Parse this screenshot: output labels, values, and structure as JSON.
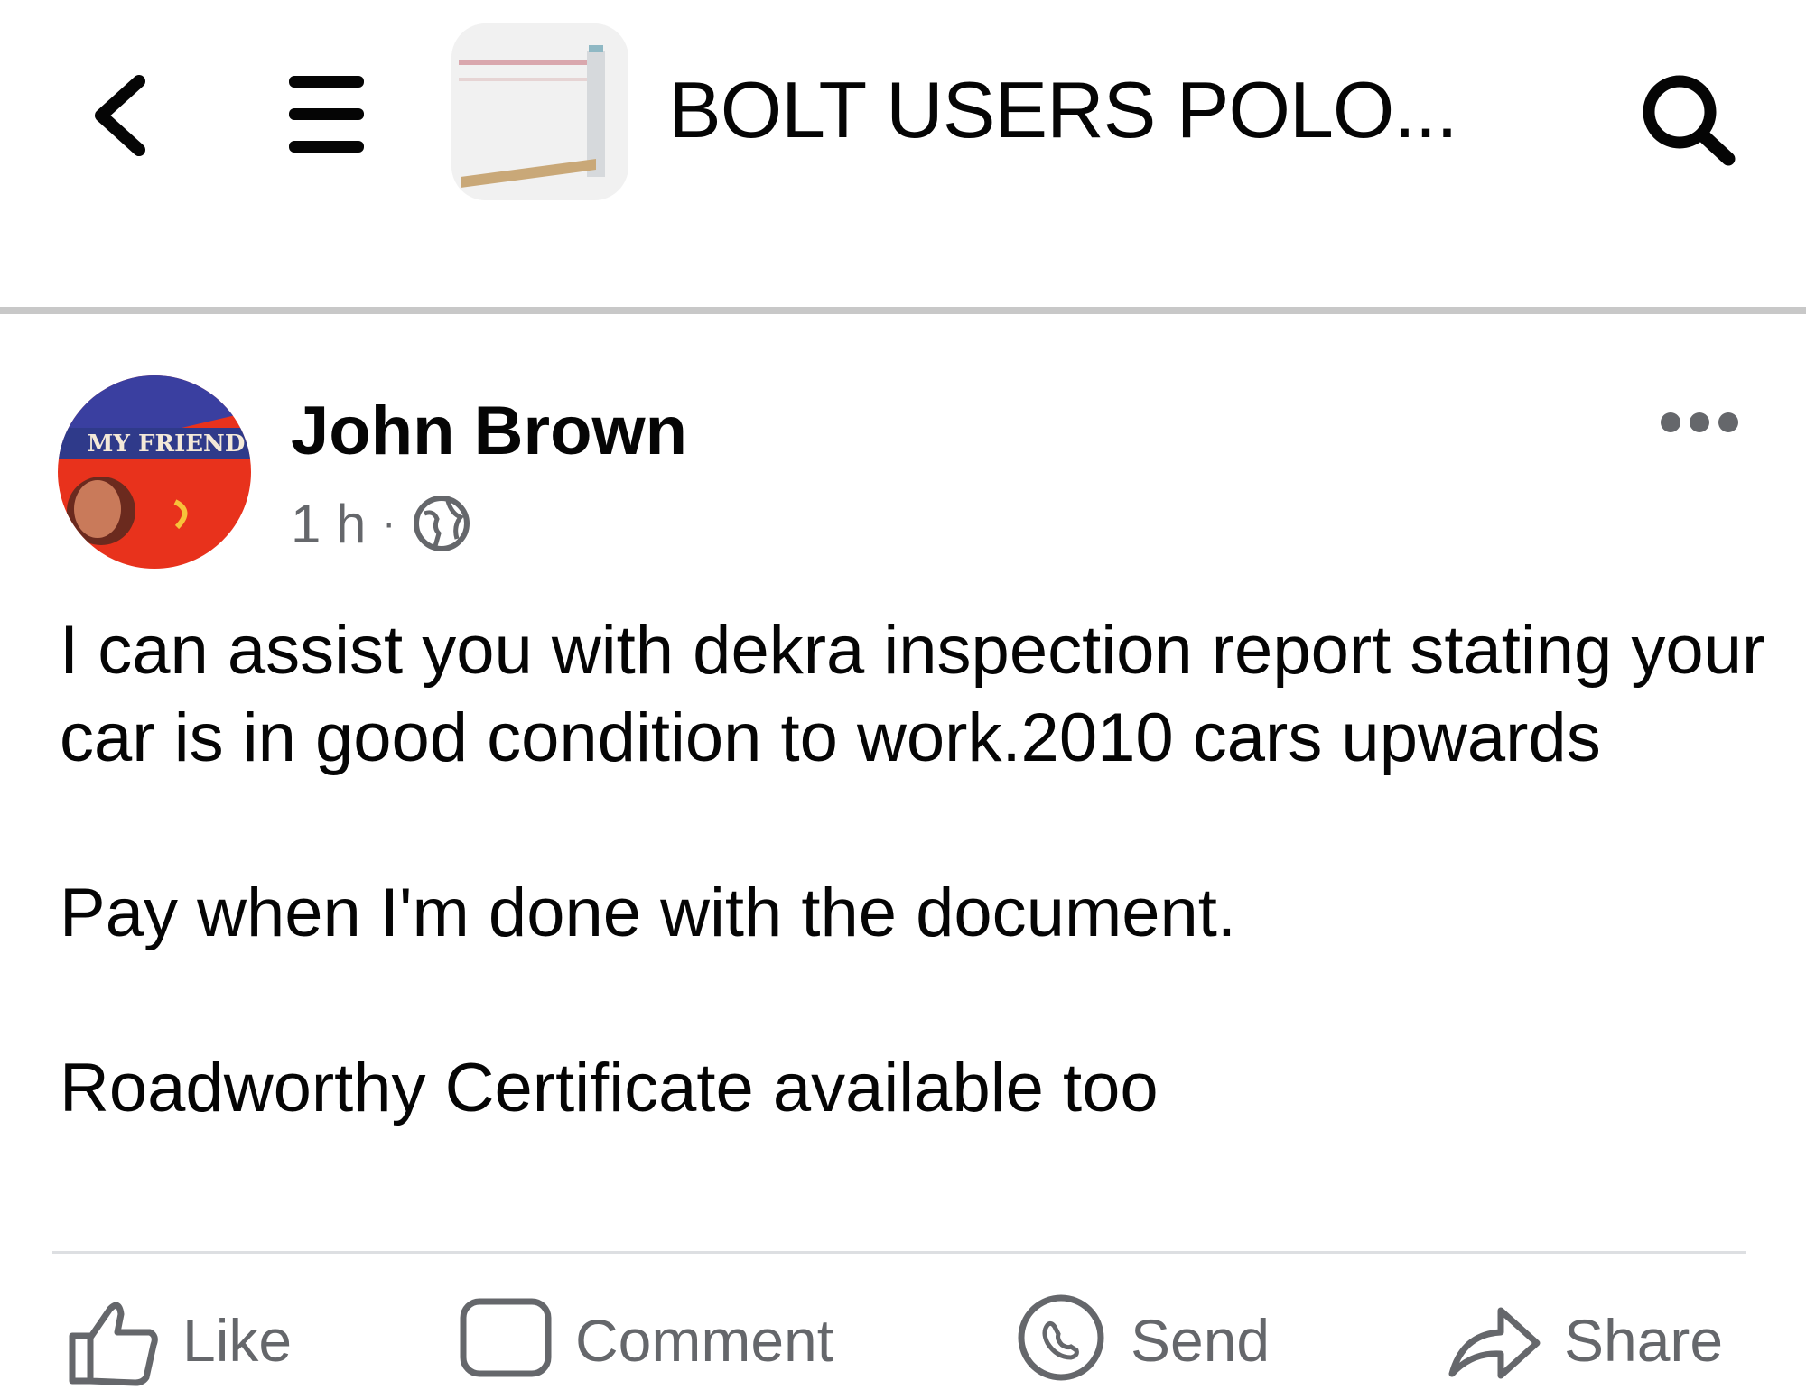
{
  "header": {
    "back_icon": "chevron-left-icon",
    "menu_icon": "hamburger-menu-icon",
    "group_title": "BOLT USERS POLO...",
    "search_icon": "search-icon"
  },
  "post": {
    "author": "John Brown",
    "avatar_text": "MY FRIEND",
    "time": "1 h",
    "separator": "·",
    "audience_icon": "globe-icon",
    "more_icon": "more-horizontal-icon",
    "paragraphs": [
      "I can assist you with dekra inspection report stating your car is in good condition to work.2010 cars upwards",
      "Pay when I'm done with the document.",
      "Roadworthy Certificate available too"
    ]
  },
  "actions": [
    {
      "label": "Like",
      "icon": "thumbs-up-icon"
    },
    {
      "label": "Comment",
      "icon": "comment-icon"
    },
    {
      "label": "Send",
      "icon": "messenger-icon"
    },
    {
      "label": "Share",
      "icon": "share-icon"
    }
  ],
  "colors": {
    "text": "#050505",
    "secondary": "#65676b",
    "divider": "#c8c8c8",
    "avatar_bg": "#e8321c"
  }
}
